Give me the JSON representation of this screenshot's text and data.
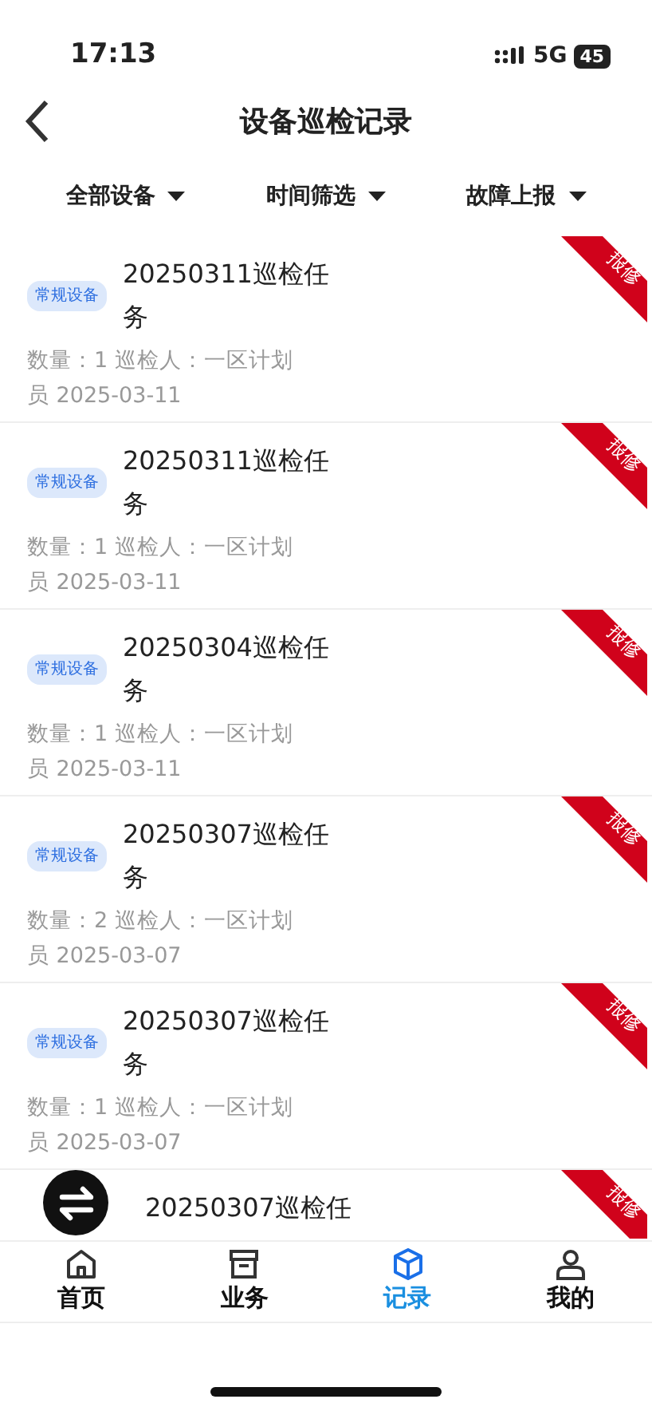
{
  "status_bar": {
    "time": "17:13",
    "network": "5G",
    "battery": "45"
  },
  "header": {
    "title": "设备巡检记录"
  },
  "filters": [
    {
      "label": "全部设备"
    },
    {
      "label": "时间筛选"
    },
    {
      "label": "故障上报"
    }
  ],
  "records": [
    {
      "tag": "常规设备",
      "title": "20250311巡检任务",
      "meta": "数量：1 巡检人：一区计划员 2025-03-11",
      "ribbon": "报修"
    },
    {
      "tag": "常规设备",
      "title": "20250311巡检任务",
      "meta": "数量：1 巡检人：一区计划员 2025-03-11",
      "ribbon": "报修"
    },
    {
      "tag": "常规设备",
      "title": "20250304巡检任务",
      "meta": "数量：1 巡检人：一区计划员 2025-03-11",
      "ribbon": "报修"
    },
    {
      "tag": "常规设备",
      "title": "20250307巡检任务",
      "meta": "数量：2 巡检人：一区计划员 2025-03-07",
      "ribbon": "报修"
    },
    {
      "tag": "常规设备",
      "title": "20250307巡检任务",
      "meta": "数量：1 巡检人：一区计划员 2025-03-07",
      "ribbon": "报修"
    },
    {
      "title": "20250307巡检任",
      "ribbon": "报修"
    }
  ],
  "tabs": [
    {
      "label": "首页",
      "kind": "home",
      "selected": false
    },
    {
      "label": "业务",
      "kind": "box",
      "selected": false
    },
    {
      "label": "记录",
      "kind": "cube",
      "selected": true
    },
    {
      "label": "我的",
      "kind": "user",
      "selected": false
    }
  ]
}
